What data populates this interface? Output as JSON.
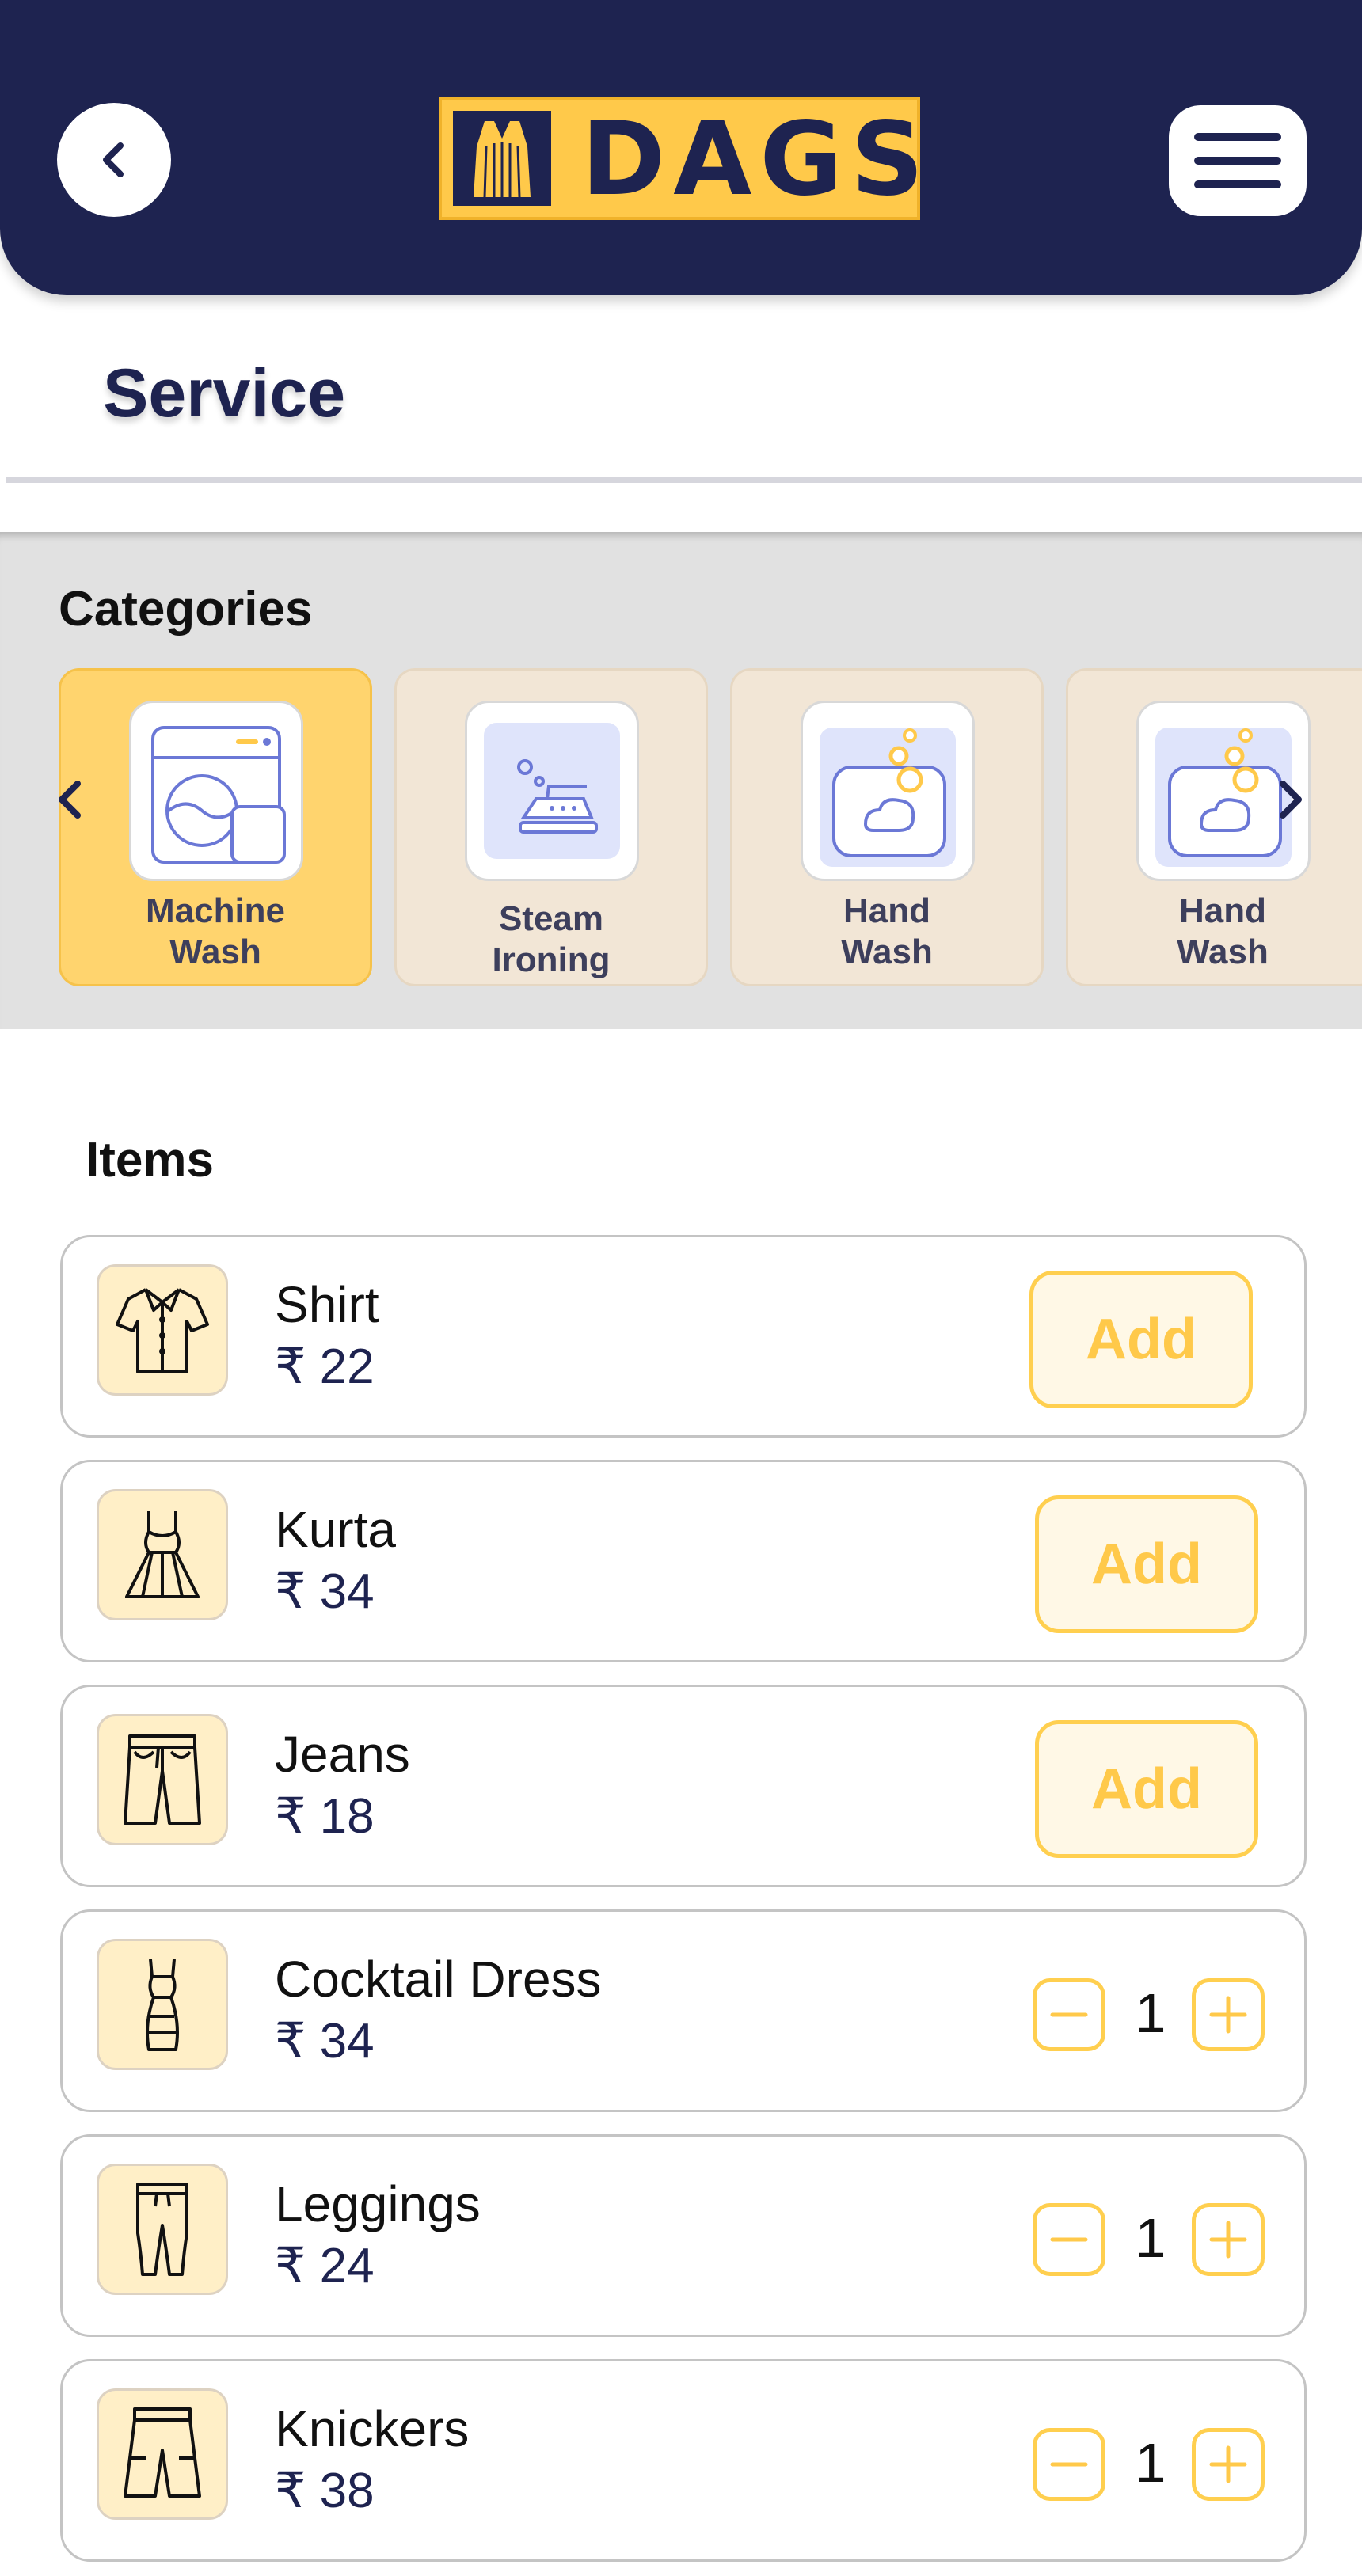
{
  "header": {
    "logo_text": "DAGS"
  },
  "page_title": "Service",
  "categories": {
    "heading": "Categories",
    "items": [
      {
        "label": "Machine Wash",
        "icon": "washing-machine-icon",
        "active": true
      },
      {
        "label": "Steam Ironing",
        "icon": "steam-iron-icon",
        "active": false
      },
      {
        "label": "Hand Wash",
        "icon": "hand-wash-icon",
        "active": false
      },
      {
        "label": "Hand Wash",
        "icon": "hand-wash-icon",
        "active": false
      }
    ]
  },
  "items": {
    "heading": "Items",
    "list": [
      {
        "name": "Shirt",
        "price": "₹ 22",
        "icon": "shirt-icon",
        "action": "Add"
      },
      {
        "name": "Kurta",
        "price": "₹ 34",
        "icon": "kurta-icon",
        "action": "Add"
      },
      {
        "name": "Jeans",
        "price": "₹ 18",
        "icon": "jeans-icon",
        "action": "Add"
      },
      {
        "name": "Cocktail Dress",
        "price": "₹ 34",
        "icon": "cocktail-dress-icon",
        "quantity": "1"
      },
      {
        "name": "Leggings",
        "price": "₹ 24",
        "icon": "leggings-icon",
        "quantity": "1"
      },
      {
        "name": "Knickers",
        "price": "₹ 38",
        "icon": "knickers-icon",
        "quantity": "1"
      }
    ]
  },
  "colors": {
    "navy": "#1e2350",
    "accent_yellow": "#ffc94a",
    "card_beige": "#f2e6d6",
    "icon_blue": "#dfe4fb"
  }
}
